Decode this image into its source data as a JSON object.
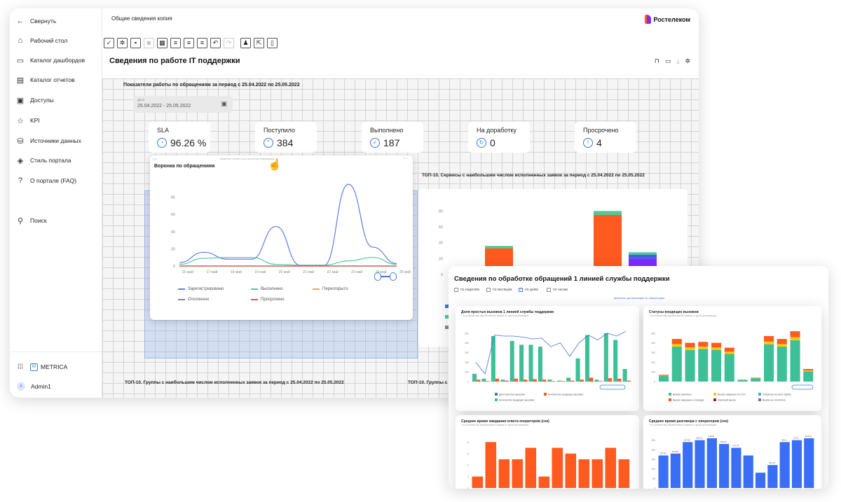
{
  "sidebar": {
    "collapse_label": "Свернуть",
    "items": [
      {
        "label": "Рабочий стол",
        "icon": "home-icon"
      },
      {
        "label": "Каталог дашбордов",
        "icon": "dashboard-icon"
      },
      {
        "label": "Каталог отчетов",
        "icon": "report-icon"
      },
      {
        "label": "Доступы",
        "icon": "access-icon"
      },
      {
        "label": "KPI",
        "icon": "kpi-icon"
      },
      {
        "label": "Источники данных",
        "icon": "database-icon"
      },
      {
        "label": "Стиль портала",
        "icon": "paint-icon"
      },
      {
        "label": "О портале (FAQ)",
        "icon": "help-icon"
      }
    ],
    "search_label": "Поиск",
    "brand": "METRICA",
    "user": "Admin1",
    "user_initial": "A"
  },
  "header": {
    "breadcrumb": "Общие сведения копия",
    "logo_text": "Ростелеком",
    "page_title": "Сведения по работе IT поддержки"
  },
  "dashboard": {
    "section_title": "Показатели работы по обращениям за период с 25.04.2022 по 25.05.2022",
    "date_filter": {
      "label": "Дата",
      "value": "25.04.2022 - 25.05.2022"
    },
    "kpis": [
      {
        "label": "SLA",
        "value": "96.26 %",
        "icon": "sla-icon"
      },
      {
        "label": "Поступило",
        "value": "384",
        "icon": "incoming-icon"
      },
      {
        "label": "Выполнено",
        "value": "187",
        "icon": "done-icon"
      },
      {
        "label": "На доработку",
        "value": "0",
        "icon": "rework-icon"
      },
      {
        "label": "Просрочено",
        "value": "4",
        "icon": "overdue-icon"
      }
    ],
    "top10_services_title": "ТОП-10. Сервисы с наибольшим числом исполненных заявок за период с 25.04.2022 по 25.05.2022",
    "top10_groups_title": "ТОП-10. Группы с наибольшим числом исполненных заявок за период с 25.04.2022 по 25.05.2022",
    "top10_groups_title_short": "ТОП-10. Группы с"
  },
  "funnel": {
    "title": "Воронка по обращениям",
    "dim_text": "Выделите элемент для просмотра информации"
  },
  "chart_data": [
    {
      "type": "line",
      "title": "Воронка по обращениям",
      "categories": [
        "15 май",
        "17 май",
        "19 май",
        "19 май",
        "20 май",
        "21 май",
        "22 май",
        "23 май",
        "24 май",
        "25 май"
      ],
      "ylim": [
        0,
        100
      ],
      "yticks": [
        0,
        20,
        40,
        60,
        80
      ],
      "series": [
        {
          "name": "Зарегистрировано",
          "color": "#5b7ee5",
          "values": [
            4,
            16,
            8,
            8,
            46,
            1,
            1,
            95,
            22,
            3
          ]
        },
        {
          "name": "Выполнено",
          "color": "#4ecb9a",
          "values": [
            2,
            9,
            10,
            10,
            2,
            1,
            1,
            6,
            10,
            2
          ]
        },
        {
          "name": "Переоткрыто",
          "color": "#f4a261",
          "values": [
            0,
            0,
            0,
            0,
            0,
            0,
            0,
            0,
            0,
            0
          ]
        },
        {
          "name": "Отклонено",
          "color": "#888888",
          "values": [
            0,
            0,
            0,
            0,
            0,
            0,
            0,
            0,
            0,
            0
          ]
        },
        {
          "name": "Просрочено",
          "color": "#e05555",
          "values": [
            0,
            0,
            0,
            0,
            0,
            0,
            0,
            0,
            0,
            0
          ]
        }
      ]
    },
    {
      "type": "bar",
      "title": "ТОП-10. Сервисы с наибольшим числом исполненных заявок за период с 25.04.2022 по 25.05.2022",
      "yticks": [
        0,
        20,
        40,
        60,
        80
      ],
      "ylim": [
        0,
        90
      ],
      "bars": [
        {
          "segments": [
            {
              "value": 33,
              "color": "#ff5a1f"
            },
            {
              "value": 3,
              "color": "#4ecb9a"
            }
          ]
        },
        {
          "segments": [
            {
              "value": 5,
              "color": "#ffcc00"
            },
            {
              "value": 70,
              "color": "#ff5a1f"
            },
            {
              "value": 5,
              "color": "#4ecb9a"
            }
          ]
        },
        {
          "segments": [
            {
              "value": 20,
              "color": "#7a2fff"
            },
            {
              "value": 5,
              "color": "#4a5fe5"
            },
            {
              "value": 3,
              "color": "#4ecb9a"
            }
          ]
        }
      ]
    },
    {
      "type": "bar",
      "title": "Доля простых вызовов 1 линией службы поддержки",
      "legend": [
        "Доля простых вызовов",
        "Количество входящих вызовов",
        "Количество входящих вызовов"
      ],
      "series": [
        {
          "name": "Количество входящих вызовов",
          "color": "#3dbf98",
          "values": [
            80,
            30,
            470,
            20,
            420,
            380,
            380,
            360,
            20,
            10,
            40,
            240,
            480,
            20,
            500,
            430,
            130
          ]
        },
        {
          "name": "Количество входящих вызовов",
          "color": "#ff5a1f",
          "values": [
            20,
            5,
            30,
            10,
            30,
            20,
            25,
            20,
            5,
            5,
            10,
            20,
            40,
            5,
            35,
            30,
            10
          ]
        }
      ],
      "line": {
        "name": "Доля простых вызовов",
        "color": "#4a6fe5",
        "values": [
          200,
          80,
          480,
          470,
          470,
          460,
          440,
          450,
          360,
          400,
          260,
          400,
          480,
          430,
          500,
          470,
          520
        ]
      }
    },
    {
      "type": "bar",
      "title": "Статусы входящих вызовов",
      "legend": [
        "Вызов принятых",
        "Вызов завершен по СУЗ",
        "Оператор не взял трубку",
        "Вызов завершен в очереди",
        "Короткий вызов",
        "Вызов не состоялся"
      ],
      "stack_totals": [
        70,
        440,
        400,
        410,
        400,
        350,
        20,
        40,
        470,
        440,
        520,
        130
      ]
    },
    {
      "type": "bar",
      "title": "Среднее время ожидания ответа оператором (сек)",
      "values": [
        2,
        8,
        5,
        5,
        7,
        2,
        7,
        6,
        5,
        5,
        7,
        5
      ],
      "color": "#ff5a1f"
    },
    {
      "type": "bar",
      "title": "Среднее время разговора с оператором (сек)",
      "values": [
        170,
        180,
        240,
        250,
        260,
        230,
        210,
        170,
        80,
        120,
        240,
        250,
        260
      ],
      "data_labels": [
        "170.95",
        "194.85",
        "217.80",
        "256.91",
        "243.01",
        "202.92",
        "170.75",
        "",
        "",
        "113.13",
        "205.3",
        "212.3",
        "243.81"
      ],
      "color": "#3a6ff5"
    }
  ],
  "second_window": {
    "title": "Сведения по обработке обращений 1 линией службы поддержки",
    "checks": [
      "по неделям",
      "по месяцам",
      "по дням",
      "по часам"
    ],
    "checked_index": 2,
    "link": "включить детализацию по операторам",
    "card1_title": "Доля простых вызовов 1 линией службы поддержки",
    "card2_title": "Статусы входящих вызовов",
    "card3_title": "Среднее время ожидания ответа оператором (сек)",
    "card4_title": "Среднее время разговора с оператором (сек)",
    "card_sub": "* по количеству обработанных заявок от доля организаций"
  },
  "colors": {
    "accent": "#3a7bd5",
    "orange": "#ff5a1f",
    "teal": "#3dbf98",
    "brand": "#7a2fff"
  }
}
